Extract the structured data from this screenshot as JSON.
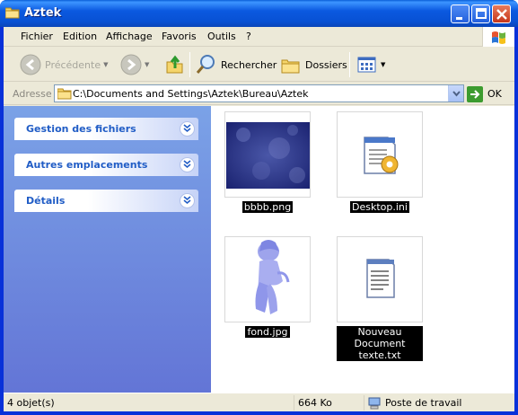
{
  "window": {
    "title": "Aztek",
    "icon": "folder-icon",
    "controls": [
      "minimize",
      "maximize",
      "close"
    ]
  },
  "menu": {
    "items": [
      "Fichier",
      "Edition",
      "Affichage",
      "Favoris",
      "Outils",
      "?"
    ]
  },
  "toolbar": {
    "back_label": "Précédente",
    "search_label": "Rechercher",
    "folders_label": "Dossiers"
  },
  "address": {
    "label": "Adresse",
    "path": "C:\\Documents and Settings\\Aztek\\Bureau\\Aztek",
    "go_label": "OK"
  },
  "taskpane": {
    "sections": [
      "Gestion des fichiers",
      "Autres emplacements",
      "Détails"
    ]
  },
  "files": [
    {
      "name": "bbbb.png",
      "kind": "image-thumbnail"
    },
    {
      "name": "Desktop.ini",
      "kind": "config-icon"
    },
    {
      "name": "fond.jpg",
      "kind": "image-thumbnail"
    },
    {
      "name": "Nouveau Document",
      "name_line2": "texte.txt",
      "kind": "text-icon"
    }
  ],
  "status": {
    "count": "4 objet(s)",
    "size": "664 Ko",
    "location": "Poste de travail"
  },
  "colors": {
    "titlebar": "#0a59e0",
    "taskpane_top": "#7ba2e7",
    "taskpane_bottom": "#6375d6",
    "task_label": "#215dc6",
    "chrome": "#ece9d8"
  }
}
